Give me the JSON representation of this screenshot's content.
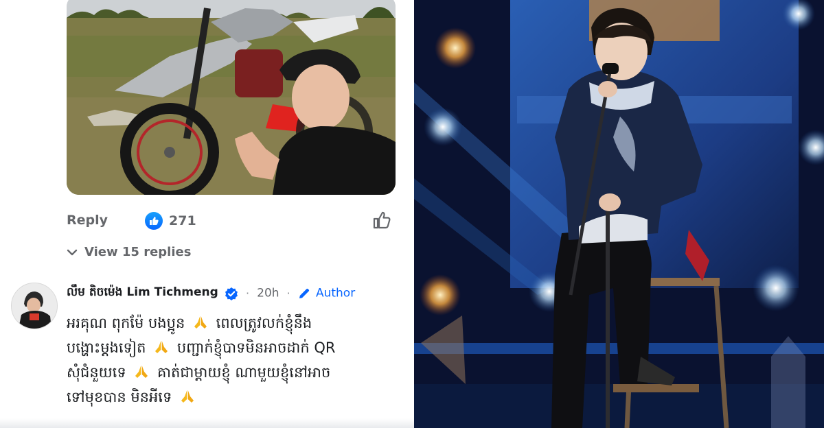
{
  "comment_thread": {
    "reply_label": "Reply",
    "like_count": "271",
    "view_replies_label": "View 15 replies",
    "comment": {
      "author_name": "លឹម តិចម៉េង Lim Tichmeng",
      "separator": "·",
      "time": "20h",
      "author_badge": "Author",
      "lines": [
        [
          "អរគុណ ពុកម៉ែ បងប្អូន",
          "ពេលត្រូវលក់ខ្ញុំនឹង"
        ],
        [
          "បង្ហោះម្តងទៀត",
          "បញ្ជាក់ខ្ញុំបាទមិនអាចដាក់ QR"
        ],
        [
          "សុំជំនួយទេ",
          "គាត់ជាម្តាយខ្ញុំ ណាមួយខ្ញុំនៅអាច"
        ],
        [
          "ទៅមុខបាន មិនអីទេ",
          ""
        ]
      ],
      "emoji_icon": "folded-hands-icon"
    }
  },
  "icons": {
    "like_badge": "thumbs-up-icon",
    "like_button": "thumbs-up-outline-icon",
    "expand": "chevron-down-icon",
    "verified": "verified-badge-icon",
    "author": "pencil-icon"
  },
  "colors": {
    "facebook_blue": "#0866ff",
    "secondary_text": "#65676b",
    "primary_text": "#1c1e21",
    "stage_background": "#0a1024"
  }
}
